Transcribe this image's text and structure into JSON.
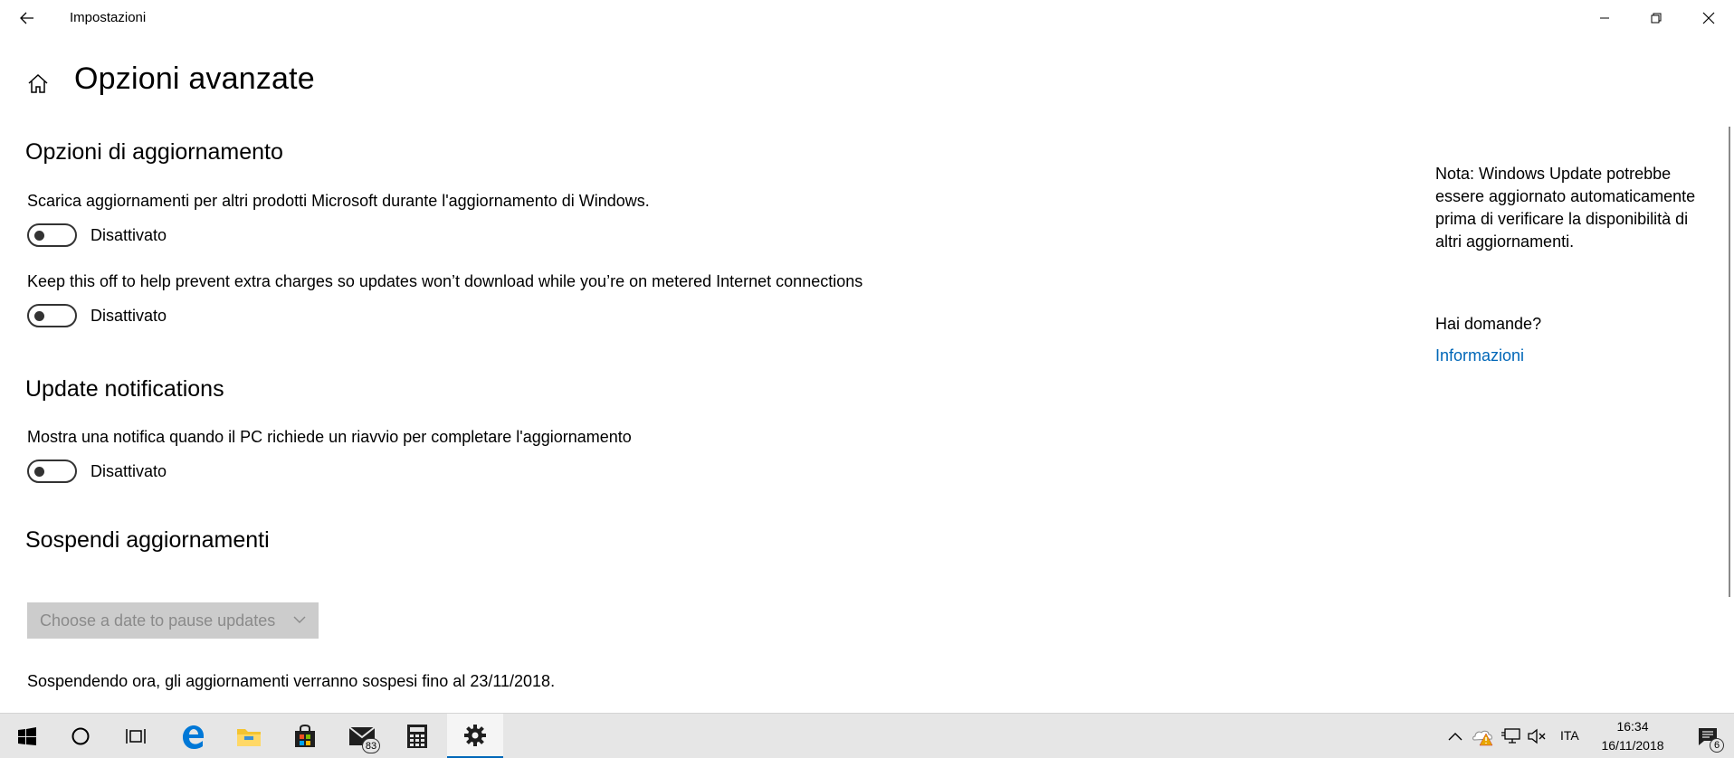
{
  "window": {
    "title": "Impostazioni"
  },
  "header": {
    "title": "Opzioni avanzate"
  },
  "sections": {
    "update_options": {
      "title": "Opzioni di aggiornamento",
      "setting1_desc": "Scarica aggiornamenti per altri prodotti Microsoft durante l'aggiornamento di Windows.",
      "setting1_state": "Disattivato",
      "setting2_desc": "Keep this off to help prevent extra charges so updates won’t download while you’re on metered Internet connections",
      "setting2_state": "Disattivato"
    },
    "notifications": {
      "title": "Update notifications",
      "setting_desc": "Mostra una notifica quando il PC richiede un riavvio per completare l'aggiornamento",
      "setting_state": "Disattivato"
    },
    "pause": {
      "title": "Sospendi aggiornamenti",
      "dropdown_label": "Choose a date to pause updates",
      "note": "Sospendendo ora, gli aggiornamenti verranno sospesi fino al 23/11/2018."
    }
  },
  "side_panel": {
    "note": "Nota: Windows Update potrebbe essere aggiornato automaticamente prima di verificare la disponibilità di altri aggiornamenti.",
    "question": "Hai domande?",
    "link": "Informazioni"
  },
  "taskbar": {
    "apps": [
      {
        "icon": "windows-start-icon"
      },
      {
        "icon": "cortana-search-icon"
      },
      {
        "icon": "task-view-icon"
      },
      {
        "icon": "edge-browser-icon"
      },
      {
        "icon": "file-explorer-icon"
      },
      {
        "icon": "store-icon"
      },
      {
        "icon": "mail-icon",
        "badge": "83"
      },
      {
        "icon": "calculator-icon"
      },
      {
        "icon": "settings-gear-icon",
        "active": true
      }
    ],
    "tray": {
      "language": "ITA",
      "time": "16:34",
      "date": "16/11/2018",
      "notifications_count": "6"
    }
  },
  "colors": {
    "accent": "#0067b8",
    "taskbar_bg": "#e6e6e6",
    "disabled_dropdown_bg": "#cccccc",
    "disabled_text": "#8a8a8a"
  }
}
